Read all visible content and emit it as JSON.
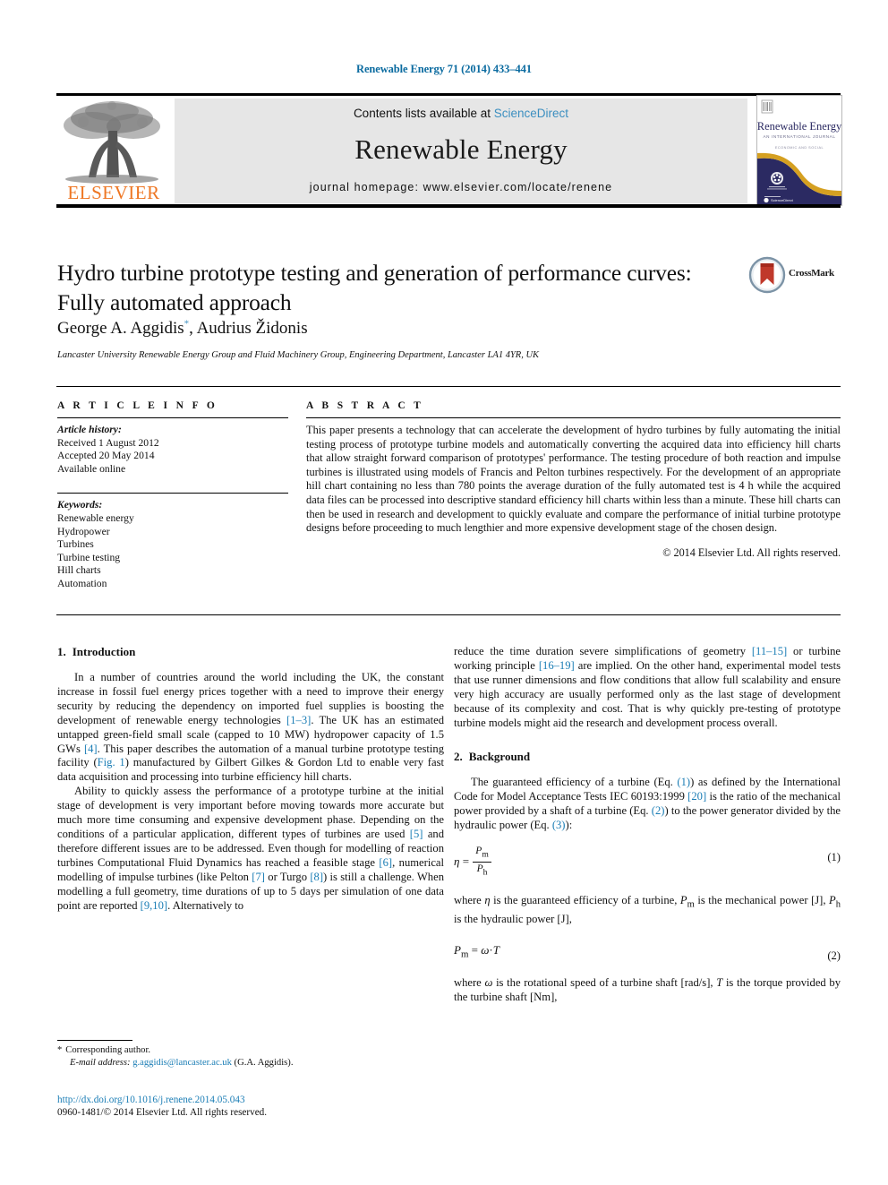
{
  "running_head": "Renewable Energy 71 (2014) 433–441",
  "masthead": {
    "contents_prefix": "Contents lists available at ",
    "sciencedirect": "ScienceDirect",
    "journal_title": "Renewable Energy",
    "homepage": "journal homepage: www.elsevier.com/locate/renene",
    "publisher_name": "ELSEVIER",
    "cover_title": "Renewable Energy",
    "cover_subtitle": "AN INTERNATIONAL JOURNAL",
    "cover_line3": "ECONOMIC AND SOCIAL"
  },
  "article": {
    "title": "Hydro turbine prototype testing and generation of performance curves: Fully automated approach",
    "authors": "George A. Aggidis, Audrius Židonis",
    "corresponding_marker": "*",
    "affiliation": "Lancaster University Renewable Energy Group and Fluid Machinery Group, Engineering Department, Lancaster LA1 4YR, UK",
    "crossmark_label": "CrossMark"
  },
  "info": {
    "heading": "A R T I C L E   I N F O",
    "history_label": "Article history:",
    "history": [
      "Received 1 August 2012",
      "Accepted 20 May 2014",
      "Available online"
    ],
    "keywords_label": "Keywords:",
    "keywords": [
      "Renewable energy",
      "Hydropower",
      "Turbines",
      "Turbine testing",
      "Hill charts",
      "Automation"
    ]
  },
  "abstract": {
    "heading": "A B S T R A C T",
    "text": "This paper presents a technology that can accelerate the development of hydro turbines by fully automating the initial testing process of prototype turbine models and automatically converting the acquired data into efficiency hill charts that allow straight forward comparison of prototypes' performance. The testing procedure of both reaction and impulse turbines is illustrated using models of Francis and Pelton turbines respectively. For the development of an appropriate hill chart containing no less than 780 points the average duration of the fully automated test is 4 h while the acquired data files can be processed into descriptive standard efficiency hill charts within less than a minute. These hill charts can then be used in research and development to quickly evaluate and compare the performance of initial turbine prototype designs before proceeding to much lengthier and more expensive development stage of the chosen design.",
    "copyright": "© 2014 Elsevier Ltd. All rights reserved."
  },
  "body": {
    "section1": {
      "number": "1.",
      "title": "Introduction",
      "para1_a": "In a number of countries around the world including the UK, the constant increase in fossil fuel energy prices together with a need to improve their energy security by reducing the dependency on imported fuel supplies is boosting the development of renewable energy technologies ",
      "ref1": "[1–3]",
      "para1_b": ". The UK has an estimated untapped green-field small scale (capped to 10 MW) hydropower capacity of 1.5 GWs ",
      "ref2": "[4]",
      "para1_c": ". This paper describes the automation of a manual turbine prototype testing facility (",
      "ref3": "Fig. 1",
      "para1_d": ") manufactured by Gilbert Gilkes & Gordon Ltd to enable very fast data acquisition and processing into turbine efficiency hill charts.",
      "para2_a": "Ability to quickly assess the performance of a prototype turbine at the initial stage of development is very important before moving towards more accurate but much more time consuming and expensive development phase. Depending on the conditions of a particular application, different types of turbines are used ",
      "ref4": "[5]",
      "para2_b": " and therefore different issues are to be addressed. Even though for modelling of reaction turbines Computational Fluid Dynamics has reached a feasible stage ",
      "ref5": "[6]",
      "para2_c": ", numerical modelling of impulse turbines (like Pelton ",
      "ref6": "[7]",
      "para2_d": " or Turgo ",
      "ref7": "[8]",
      "para2_e": ") is still a challenge. When modelling a full geometry, time durations of up to 5 days per simulation of one data point are reported ",
      "ref8": "[9,10]",
      "para2_f": ". Alternatively to"
    },
    "right_continuation": {
      "part_a": "reduce the time duration severe simplifications of geometry ",
      "ref9": "[11–15]",
      "part_b": " or turbine working principle ",
      "ref10": "[16–19]",
      "part_c": " are implied. On the other hand, experimental model tests that use runner dimensions and flow conditions that allow full scalability and ensure very high accuracy are usually performed only as the last stage of development because of its complexity and cost. That is why quickly pre-testing of prototype turbine models might aid the research and development process overall."
    },
    "section2": {
      "number": "2.",
      "title": "Background",
      "para_a": "The guaranteed efficiency of a turbine (Eq. ",
      "ref_eq1": "(1)",
      "para_b": ") as defined by the International Code for Model Acceptance Tests IEC 60193:1999 ",
      "ref20": "[20]",
      "para_c": " is the ratio of the mechanical power provided by a shaft of a turbine (Eq. ",
      "ref_eq2": "(2)",
      "para_d": ") to the power generator divided by the hydraulic power (Eq. ",
      "ref_eq3": "(3)",
      "para_e": "):",
      "eq1_number": "(1)",
      "eq1_lhs": "η",
      "eq1_eq": "=",
      "eq1_num": "P",
      "eq1_num_sub": "m",
      "eq1_den": "P",
      "eq1_den_sub": "h",
      "where1_a": "where ",
      "where1_eta": "η",
      "where1_b": " is the guaranteed efficiency of a turbine, ",
      "where1_pm": "P",
      "where1_pm_sub": "m",
      "where1_c": " is the mechanical power [J], ",
      "where1_ph": "P",
      "where1_ph_sub": "h",
      "where1_d": " is the hydraulic power [J],",
      "eq2_number": "(2)",
      "eq2_lhs": "P",
      "eq2_lhs_sub": "m",
      "eq2_eq": "=",
      "eq2_omega": "ω",
      "eq2_dot": "·",
      "eq2_T": "T",
      "where2_a": "where ",
      "where2_omega": "ω",
      "where2_b": " is the rotational speed of a turbine shaft [rad/s], ",
      "where2_T": "T",
      "where2_c": " is the torque provided by the turbine shaft [Nm],"
    }
  },
  "footnotes": {
    "corresponding": "Corresponding author.",
    "email_label": "E-mail address:",
    "email": "g.aggidis@lancaster.ac.uk",
    "email_suffix": "(G.A. Aggidis).",
    "doi": "http://dx.doi.org/10.1016/j.renene.2014.05.043",
    "issn_line": "0960-1481/© 2014 Elsevier Ltd. All rights reserved."
  },
  "colors": {
    "link": "#1a7db5",
    "sciencedirect": "#3c8fc0",
    "elsevier_orange": "#ee7623",
    "cover_navy": "#2b2a62",
    "cover_gold": "#d5a021",
    "crossmark_red": "#c0392b",
    "banner_gray": "#e6e6e6"
  }
}
